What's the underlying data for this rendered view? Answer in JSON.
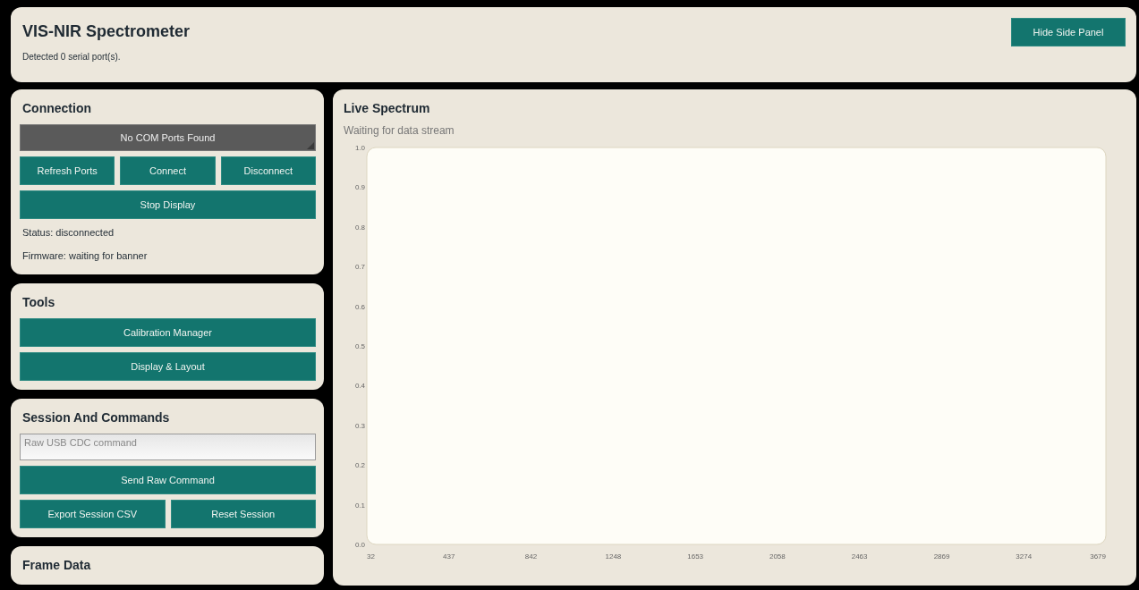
{
  "header": {
    "title": "VIS-NIR Spectrometer",
    "subtitle": "Detected 0 serial port(s).",
    "button": "Hide Side Panel"
  },
  "side_cards": [
    {
      "title": "Connection",
      "items": [
        {
          "kind": "select",
          "value": "No COM Ports Found"
        },
        {
          "kind": "buttons",
          "labels": [
            "Refresh Ports",
            "Connect",
            "Disconnect"
          ]
        },
        {
          "kind": "buttons",
          "labels": [
            "Stop Display"
          ]
        },
        {
          "kind": "text",
          "text": "Status: disconnected"
        },
        {
          "kind": "text",
          "text": "Firmware: waiting for banner"
        }
      ]
    },
    {
      "title": "Tools",
      "items": [
        {
          "kind": "buttons",
          "labels": [
            "Calibration Manager"
          ]
        },
        {
          "kind": "buttons",
          "labels": [
            "Display & Layout"
          ]
        }
      ]
    },
    {
      "title": "Session And Commands",
      "items": [
        {
          "kind": "input",
          "placeholder": "Raw USB CDC command"
        },
        {
          "kind": "buttons",
          "labels": [
            "Send Raw Command"
          ]
        },
        {
          "kind": "buttons",
          "labels": [
            "Export Session CSV",
            "Reset Session"
          ]
        }
      ]
    },
    {
      "title": "Frame Data"
    }
  ],
  "spectrum": {
    "title": "Live Spectrum",
    "status": "Waiting for data stream",
    "chart_data": {
      "type": "line",
      "xlim": [
        32,
        3679
      ],
      "ylim": [
        0,
        1
      ],
      "xticks": [
        32,
        437,
        842,
        1248,
        1653,
        2058,
        2463,
        2869,
        3274,
        3679
      ],
      "yticks": [
        {
          "value": 0,
          "label": "0.0"
        },
        {
          "value": 0.1,
          "label": "0.1"
        },
        {
          "value": 0.2,
          "label": "0.2"
        },
        {
          "value": 0.3,
          "label": "0.3"
        },
        {
          "value": 0.4,
          "label": "0.4"
        },
        {
          "value": 0.5,
          "label": "0.5"
        },
        {
          "value": 0.6,
          "label": "0.6"
        },
        {
          "value": 0.7,
          "label": "0.7"
        },
        {
          "value": 0.8,
          "label": "0.8"
        },
        {
          "value": 0.9,
          "label": "0.9"
        },
        {
          "value": 1,
          "label": "1.0"
        }
      ]
    }
  }
}
